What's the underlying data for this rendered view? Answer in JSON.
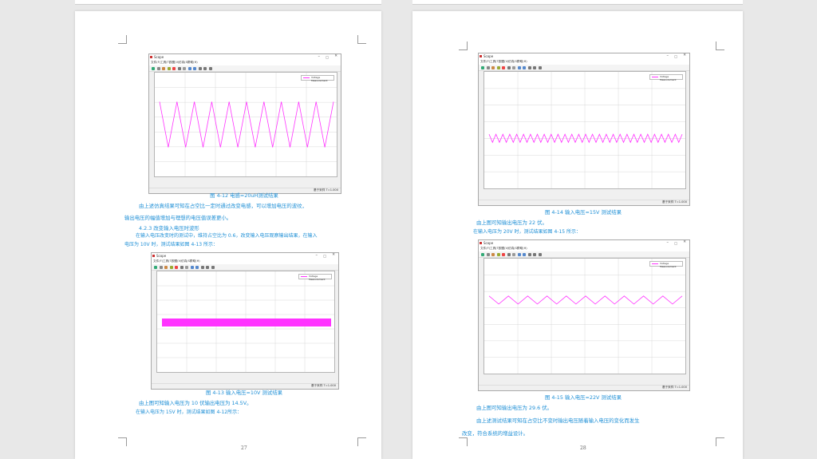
{
  "colors": {
    "caption": "#1e8fd6",
    "signal": "#ff33ff",
    "grid": "#d8d8d8"
  },
  "scope": {
    "window_title": "Scope",
    "menu": [
      "文件(F)",
      "工具(T)",
      "视图(V)",
      "仿真(S)",
      "帮助(H)"
    ],
    "legend": "Voltage Measurement",
    "status": "基于采样  T=1.000"
  },
  "page_left": {
    "caption_1": "图 4-12 电感=20uH测试结果",
    "para_1a": "由上述仿真结果可知在占空比一定时通过改变电感，可以增加电压的波纹，",
    "para_1b": "输出电压的幅值增加与理想的电压值误差更小。",
    "heading": "4.2.3 改变输入电压时波形",
    "para_2a": "在输入电压改变时的测试中，维持占空比为 0.6，改变输入电压观察输出结果，在输入",
    "para_2b": "电压为 10V 时，测试结果如图 4-13 所示：",
    "caption_2": "图 4-13 输入电压=10V 测试结果",
    "para_3": "由上图可知输入电压为 10 伏输出电压为 14.5V。",
    "para_4": "在输入电压为 15V 时，测试结果如图 4-12所示：",
    "page_number": "27"
  },
  "page_right": {
    "caption_1": "图 4-14 输入电压=15V 测试结果",
    "para_1": "由上图可知输出电压为 22 伏。",
    "para_2": "在输入电压为 20V 时，测试结果如图 4-15 所示：",
    "caption_2": "图 4-15 输入电压=22V 测试结果",
    "para_3": "由上图可知输出电压为 29.6 伏。",
    "para_4a": "由上述测试结果可知在占空比不变时输出电压随着输入电压的变化而发生",
    "para_4b": "改变，符合系统的增益设计。",
    "page_number": "28"
  },
  "waveforms": [
    {
      "figure": "4-12",
      "shape": "triangle",
      "cycles": 10,
      "ripple": "large"
    },
    {
      "figure": "4-13",
      "shape": "band",
      "ripple": "dense"
    },
    {
      "figure": "4-14",
      "shape": "triangle",
      "cycles": 28,
      "ripple": "small"
    },
    {
      "figure": "4-15",
      "shape": "triangle",
      "cycles": 10,
      "ripple": "medium"
    }
  ]
}
